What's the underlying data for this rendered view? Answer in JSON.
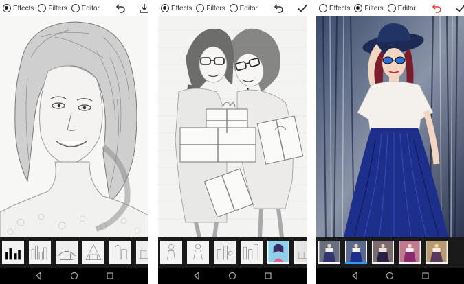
{
  "screens": [
    {
      "tabs": [
        {
          "label": "Effects",
          "checked": true
        },
        {
          "label": "Filters",
          "checked": false
        },
        {
          "label": "Editor",
          "checked": false
        }
      ],
      "actions": [
        "undo-icon",
        "download-icon"
      ],
      "active_filter": 0
    },
    {
      "tabs": [
        {
          "label": "Effects",
          "checked": true
        },
        {
          "label": "Filters",
          "checked": false
        },
        {
          "label": "Editor",
          "checked": false
        }
      ],
      "actions": [
        "undo-icon",
        "check-icon"
      ],
      "active_filter": 0
    },
    {
      "tabs": [
        {
          "label": "Effects",
          "checked": false
        },
        {
          "label": "Filters",
          "checked": true
        },
        {
          "label": "Editor",
          "checked": false
        }
      ],
      "actions": [
        "undo-icon",
        "check-icon"
      ],
      "active_filter": 1
    }
  ],
  "colors": {
    "accent": "#2f9bff",
    "undo_active": "#e53935",
    "strip_bg": "#1a1a1a",
    "navbar_bg": "#000000"
  },
  "navbar_icons": [
    "back-icon",
    "home-icon",
    "recents-icon"
  ]
}
